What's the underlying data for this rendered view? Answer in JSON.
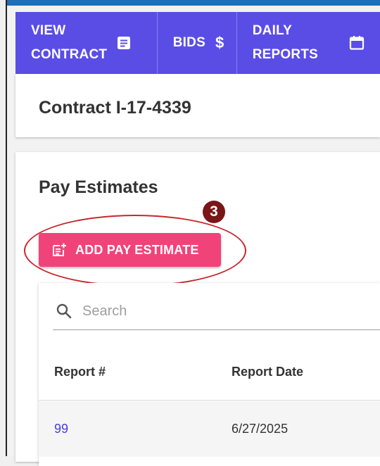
{
  "nav": {
    "items": [
      {
        "line1": "VIEW",
        "line2": "CONTRACT",
        "icon": "document-icon"
      },
      {
        "line1": "BIDS",
        "icon": "dollar-icon"
      },
      {
        "line1": "DAILY",
        "line2": "REPORTS",
        "icon": "calendar-icon"
      }
    ]
  },
  "contract": {
    "title": "Contract I-17-4339"
  },
  "pay_estimates": {
    "title": "Pay Estimates",
    "step_number": "3",
    "add_button_label": "ADD PAY ESTIMATE",
    "search_placeholder": "Search",
    "columns": [
      "Report #",
      "Report Date"
    ],
    "rows": [
      {
        "report": "99",
        "date": "6/27/2025"
      }
    ]
  },
  "colors": {
    "nav_bg": "#5a4de6",
    "accent_pink": "#f04379",
    "badge": "#7a1518",
    "highlight_ring": "#c7272c",
    "link": "#4a3ce0"
  }
}
